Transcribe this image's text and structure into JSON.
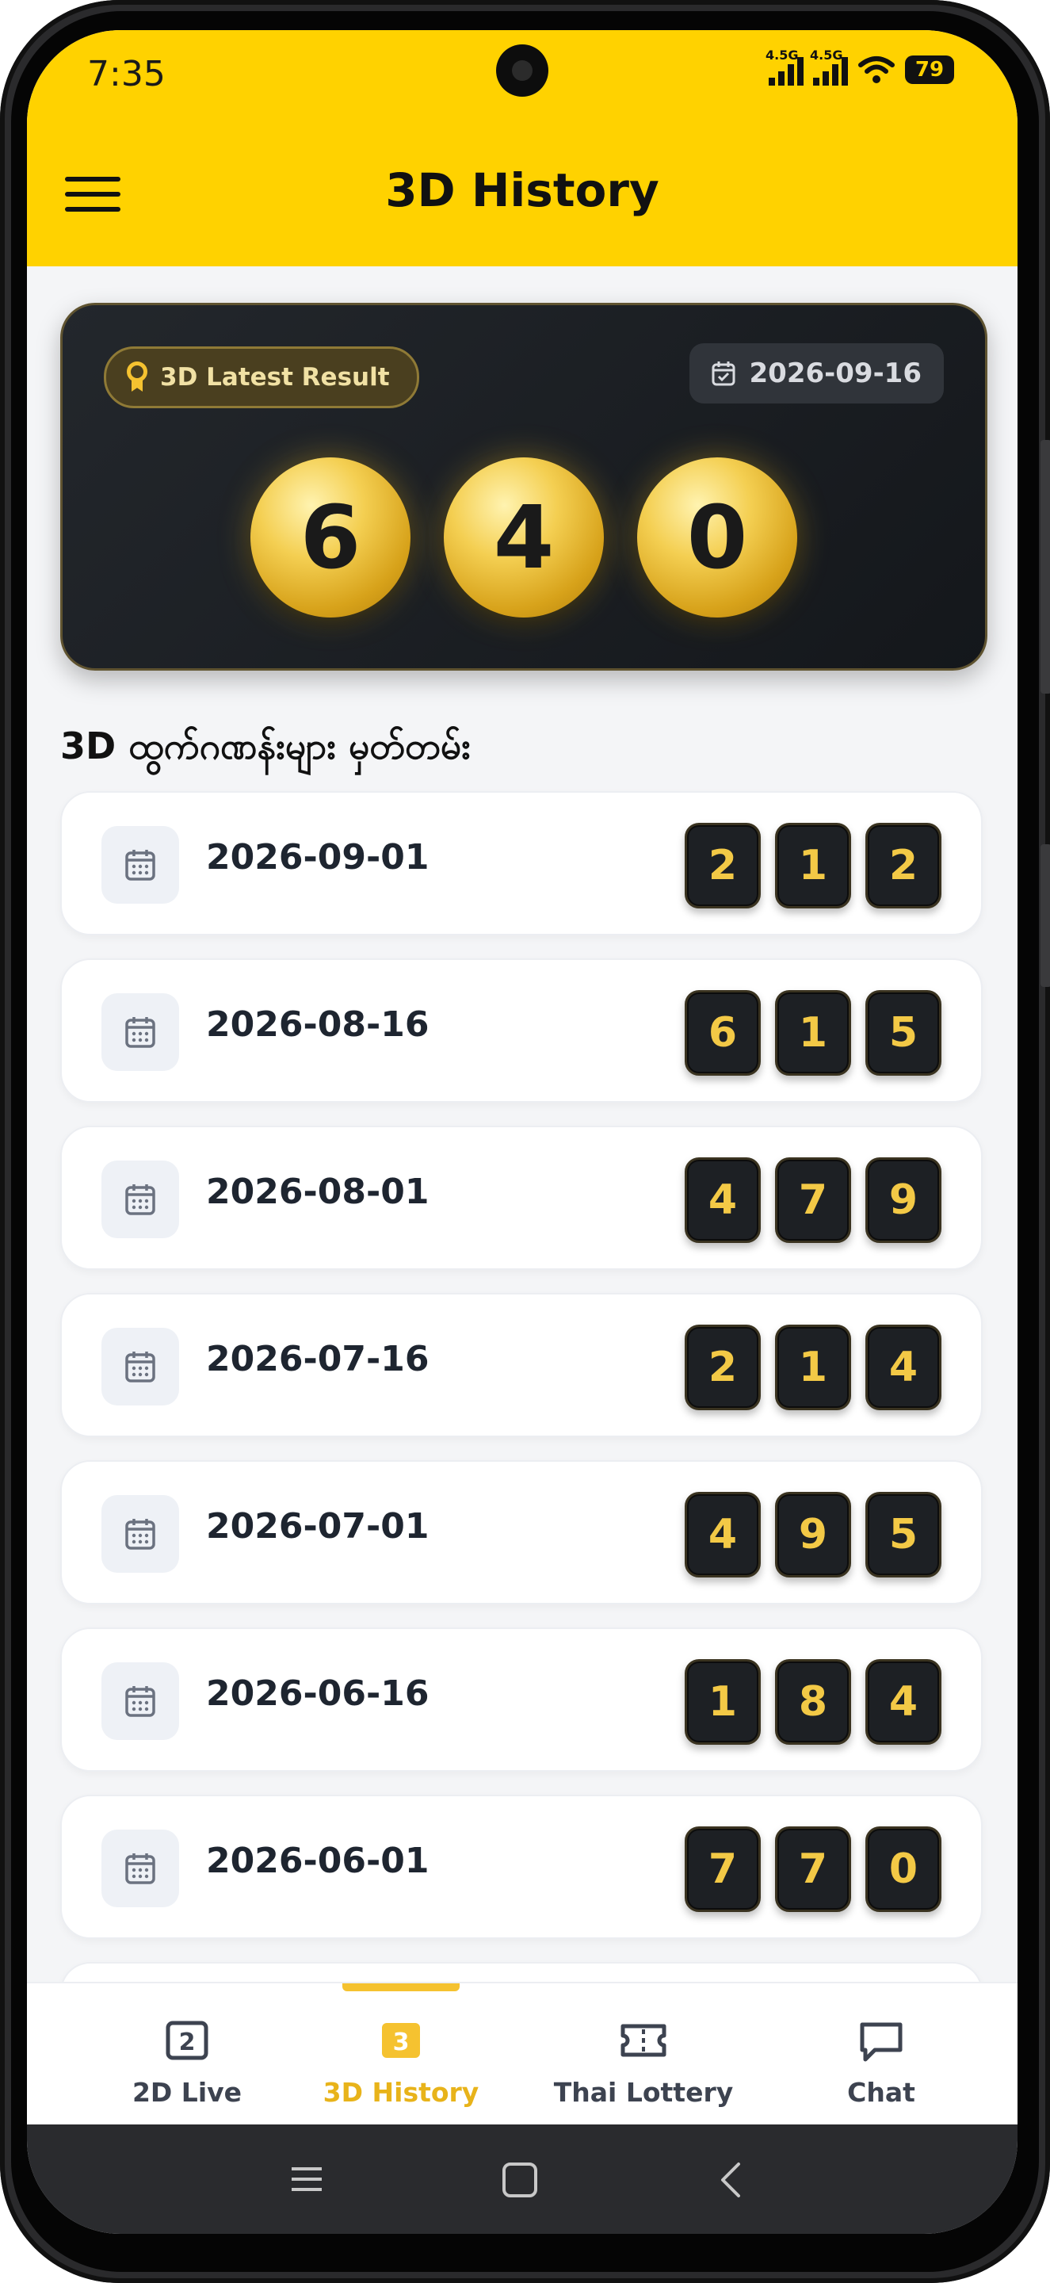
{
  "status": {
    "time": "7:35",
    "net1": "4.5G",
    "net2": "4.5G",
    "battery": "79"
  },
  "header": {
    "title": "3D History"
  },
  "latest": {
    "badge": "3D Latest Result",
    "date": "2026-09-16",
    "digits": [
      "6",
      "4",
      "0"
    ]
  },
  "section_title": "3D ထွက်ဂဏန်းများ မှတ်တမ်း",
  "history": [
    {
      "date": "2026-09-01",
      "digits": [
        "2",
        "1",
        "2"
      ]
    },
    {
      "date": "2026-08-16",
      "digits": [
        "6",
        "1",
        "5"
      ]
    },
    {
      "date": "2026-08-01",
      "digits": [
        "4",
        "7",
        "9"
      ]
    },
    {
      "date": "2026-07-16",
      "digits": [
        "2",
        "1",
        "4"
      ]
    },
    {
      "date": "2026-07-01",
      "digits": [
        "4",
        "9",
        "5"
      ]
    },
    {
      "date": "2026-06-16",
      "digits": [
        "1",
        "8",
        "4"
      ]
    },
    {
      "date": "2026-06-01",
      "digits": [
        "7",
        "7",
        "0"
      ]
    }
  ],
  "nav": {
    "items": [
      {
        "label": "2D Live",
        "icon": "2d-icon",
        "glyph": "2"
      },
      {
        "label": "3D History",
        "icon": "3d-icon",
        "glyph": "3"
      },
      {
        "label": "Thai Lottery",
        "icon": "ticket-icon"
      },
      {
        "label": "Chat",
        "icon": "chat-icon"
      }
    ],
    "active": "3D History"
  },
  "colors": {
    "brand": "#ffd200",
    "accent": "#f5c230",
    "dark": "#1d2024"
  }
}
